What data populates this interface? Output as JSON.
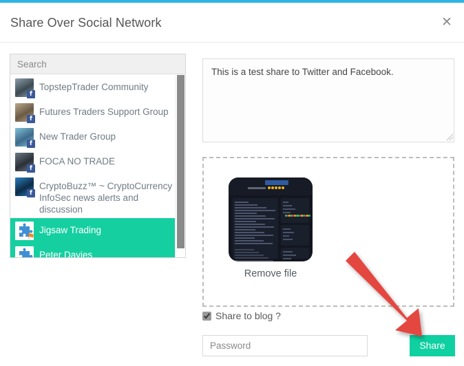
{
  "modal": {
    "title": "Share Over Social Network",
    "close_icon": "close-icon",
    "accent_color": "#2bb5e5"
  },
  "recipients_panel": {
    "search": {
      "placeholder": "Search",
      "value": ""
    },
    "items": [
      {
        "label": "TopstepTrader Community",
        "network": "facebook",
        "badge_glyph": "f",
        "selected": false
      },
      {
        "label": "Futures Traders Support Group",
        "network": "facebook",
        "badge_glyph": "f",
        "selected": false
      },
      {
        "label": "New Trader Group",
        "network": "facebook",
        "badge_glyph": "f",
        "selected": false
      },
      {
        "label": "FOCA NO TRADE",
        "network": "facebook",
        "badge_glyph": "f",
        "selected": false
      },
      {
        "label": "CryptoBuzz™ ~ CryptoCurrency & InfoSec news alerts and discussion",
        "network": "facebook",
        "badge_glyph": "f",
        "selected": false
      },
      {
        "label": "Jigsaw Trading",
        "network": "flag",
        "badge_glyph": "⚑",
        "selected": true
      },
      {
        "label": "Peter Davies",
        "network": "twitter",
        "badge_glyph": "t",
        "selected": true
      }
    ],
    "selected_color": "#16cfa1"
  },
  "composer": {
    "message_value": "This is a test share to Twitter and Facebook.",
    "message_placeholder": ""
  },
  "dropzone": {
    "remove_file_label": "Remove file",
    "thumbnail_name": "file-thumbnail"
  },
  "options": {
    "share_to_blog_label": "Share to blog ?",
    "share_to_blog_checked": true
  },
  "footer": {
    "password_placeholder": "Password",
    "password_value": "",
    "share_label": "Share",
    "share_color": "#0fd0a0"
  },
  "annotation": {
    "arrow_color": "#e4463f",
    "points_to": "share-button"
  }
}
